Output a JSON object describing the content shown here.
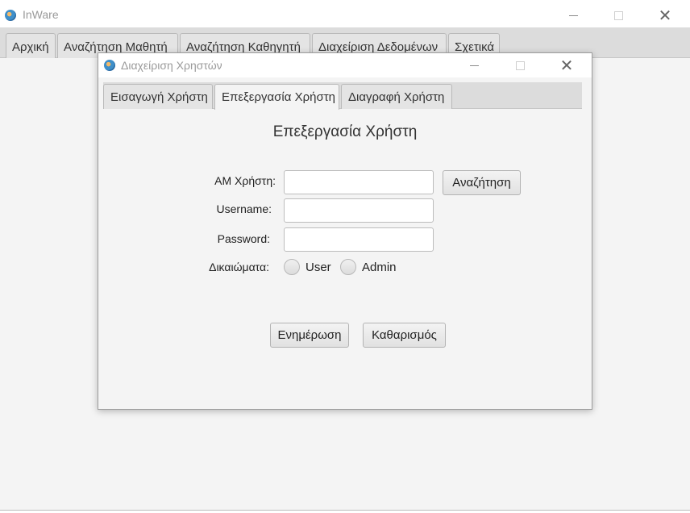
{
  "main_window": {
    "title": "InWare",
    "controls": {
      "minimize_icon": "minimize-icon",
      "maximize_icon": "maximize-icon",
      "close_icon": "close-icon"
    },
    "tabs": [
      {
        "label": "Αρχική"
      },
      {
        "label": "Αναζήτηση Μαθητή"
      },
      {
        "label": "Αναζήτηση Καθηγητή"
      },
      {
        "label": "Διαχείριση Δεδομένων"
      },
      {
        "label": "Σχετικά"
      }
    ]
  },
  "dialog": {
    "title": "Διαχείριση Χρηστών",
    "tabs": [
      {
        "label": "Εισαγωγή Χρήστη",
        "active": false
      },
      {
        "label": "Επεξεργασία Χρήστη",
        "active": true
      },
      {
        "label": "Διαγραφή Χρήστη",
        "active": false
      }
    ],
    "panel": {
      "heading": "Επεξεργασία Χρήστη",
      "fields": {
        "am_label": "ΑΜ Χρήστη:",
        "am_value": "",
        "username_label": "Username:",
        "username_value": "",
        "password_label": "Password:",
        "password_value": ""
      },
      "search_button": "Αναζήτηση",
      "rights": {
        "label": "Δικαιώματα:",
        "options": [
          {
            "label": "User",
            "selected": false
          },
          {
            "label": "Admin",
            "selected": false
          }
        ]
      },
      "update_button": "Ενημέρωση",
      "clear_button": "Καθαρισμός"
    }
  }
}
